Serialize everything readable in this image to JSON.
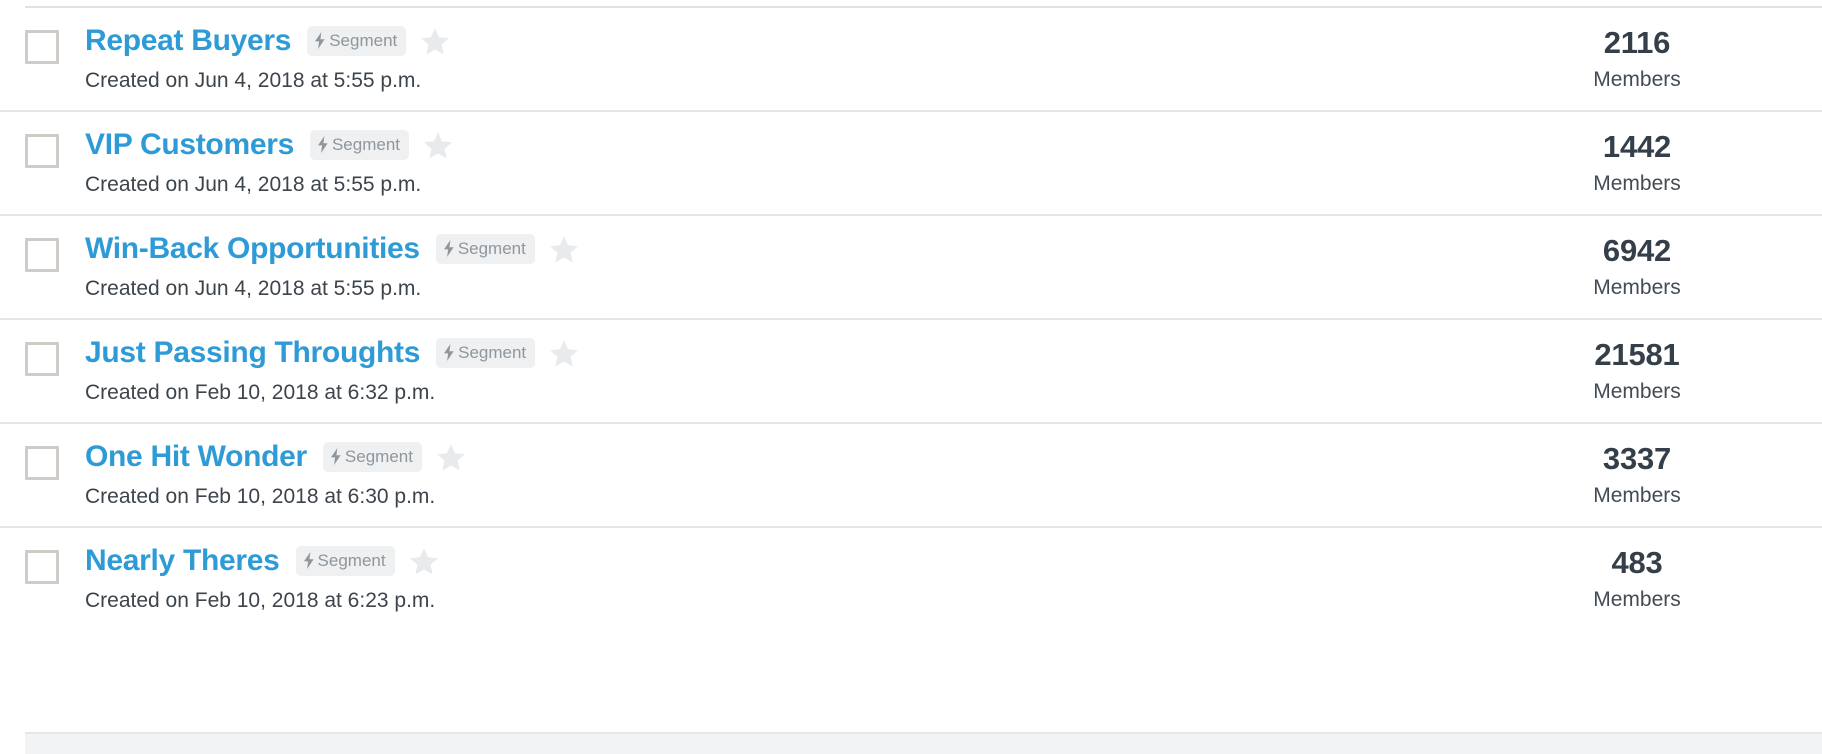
{
  "list": {
    "badge_label": "Segment",
    "badge_icon": "lightning-bolt-icon",
    "star_icon": "star-icon",
    "members_label": "Members",
    "colors": {
      "title_blue": "#2e9bd6",
      "count_dark": "#343f49",
      "badge_bg": "#eef0f1",
      "badge_text": "#8e979e",
      "star_gray": "#e6e9eb",
      "divider": "#e3e7ea",
      "checkbox_border": "#cfccc7"
    },
    "rows": [
      {
        "title": "Repeat Buyers",
        "badge": "Segment",
        "created": "Created on Jun 4, 2018 at 5:55 p.m.",
        "count": "2116",
        "members_label": "Members"
      },
      {
        "title": "VIP Customers",
        "badge": "Segment",
        "created": "Created on Jun 4, 2018 at 5:55 p.m.",
        "count": "1442",
        "members_label": "Members"
      },
      {
        "title": "Win-Back Opportunities",
        "badge": "Segment",
        "created": "Created on Jun 4, 2018 at 5:55 p.m.",
        "count": "6942",
        "members_label": "Members"
      },
      {
        "title": "Just Passing Throughts",
        "badge": "Segment",
        "created": "Created on Feb 10, 2018 at 6:32 p.m.",
        "count": "21581",
        "members_label": "Members"
      },
      {
        "title": "One Hit Wonder",
        "badge": "Segment",
        "created": "Created on Feb 10, 2018 at 6:30 p.m.",
        "count": "3337",
        "members_label": "Members"
      },
      {
        "title": "Nearly Theres",
        "badge": "Segment",
        "created": "Created on Feb 10, 2018 at 6:23 p.m.",
        "count": "483",
        "members_label": "Members"
      }
    ]
  }
}
